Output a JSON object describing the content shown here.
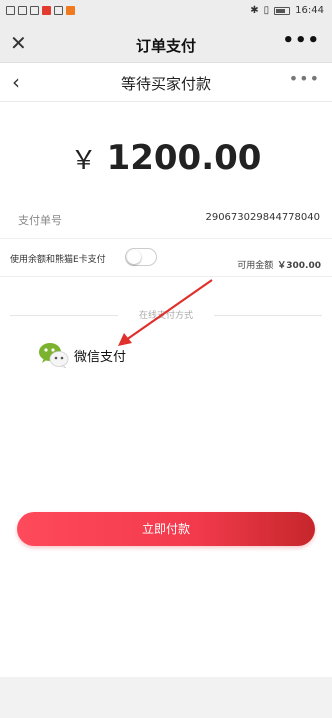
{
  "statusbar": {
    "time": "16:44"
  },
  "titlebar": {
    "title": "订单支付",
    "more": "•••",
    "close": "✕"
  },
  "header": {
    "title": "等待买家付款",
    "back": "‹",
    "more": "•••"
  },
  "amount": {
    "currency": "￥",
    "value": "1200.00"
  },
  "order": {
    "label": "支付单号",
    "number": "290673029844778040"
  },
  "balance": {
    "label": "使用余额和熊猫E卡支付",
    "available_label": "可用金额",
    "available_value": "￥300.00",
    "enabled": false
  },
  "methods_title": "在线支付方式",
  "payment_method": {
    "label": "微信支付",
    "icon": "wechat-icon"
  },
  "pay_button": "立即付款",
  "colors": {
    "accent": "#f23a4c",
    "accent_dark": "#c6262c",
    "wechat_green": "#7bb32e"
  }
}
